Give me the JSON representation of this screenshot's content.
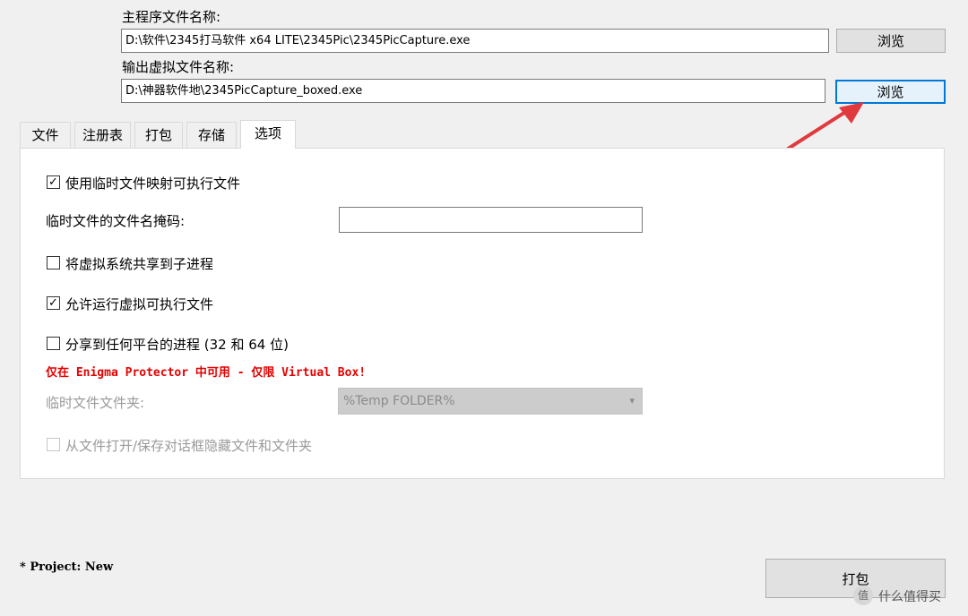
{
  "main_program": {
    "label": "主程序文件名称:",
    "value": "D:\\软件\\2345打马软件 x64 LITE\\2345Pic\\2345PicCapture.exe",
    "browse": "浏览"
  },
  "output_file": {
    "label": "输出虚拟文件名称:",
    "value": "D:\\神器软件地\\2345PicCapture_boxed.exe",
    "browse": "浏览"
  },
  "tabs": [
    {
      "label": "文件",
      "active": false
    },
    {
      "label": "注册表",
      "active": false
    },
    {
      "label": "打包",
      "active": false
    },
    {
      "label": "存储",
      "active": false
    },
    {
      "label": "选项",
      "active": true
    }
  ],
  "options": {
    "temp_map": {
      "label": "使用临时文件映射可执行文件",
      "checked": true
    },
    "temp_mask_label": "临时文件的文件名掩码:",
    "temp_mask_value": "",
    "share_child": {
      "label": "将虚拟系统共享到子进程",
      "checked": false
    },
    "allow_run": {
      "label": "允许运行虚拟可执行文件",
      "checked": true
    },
    "share_any": {
      "label": "分享到任何平台的进程 (32 和 64 位)",
      "checked": false
    },
    "warning": "仅在 Enigma Protector 中可用 - 仅限 Virtual Box!",
    "temp_folder_label": "临时文件文件夹:",
    "temp_folder_value": "%Temp FOLDER%",
    "hide_dialog": {
      "label": "从文件打开/保存对话框隐藏文件和文件夹",
      "checked": false
    }
  },
  "footer": {
    "project": "* Project: New",
    "pack_button": "打包",
    "watermark": "值 什么值得买"
  },
  "colors": {
    "accent_border": "#0078d7",
    "warning_text": "#e60000",
    "arrow": "#e0393e"
  }
}
